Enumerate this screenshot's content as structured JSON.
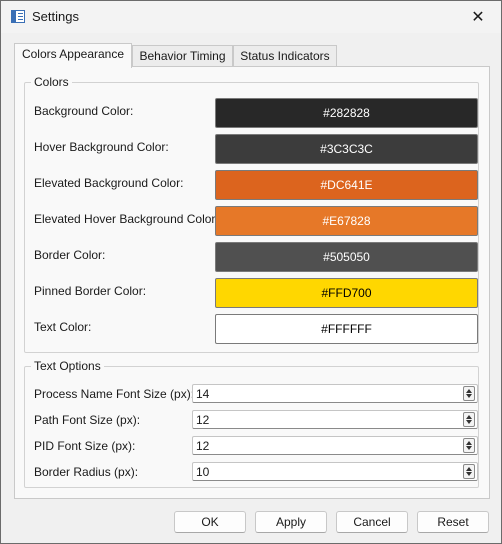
{
  "window": {
    "title": "Settings",
    "close_glyph": "✕"
  },
  "tabs": [
    {
      "label": "Colors  Appearance",
      "active": true
    },
    {
      "label": "Behavior  Timing",
      "active": false
    },
    {
      "label": "Status Indicators",
      "active": false
    }
  ],
  "colors_group": {
    "title": "Colors",
    "rows": [
      {
        "label": "Background Color:",
        "value": "#282828",
        "bg": "#282828",
        "fg": "#ffffff"
      },
      {
        "label": "Hover Background Color:",
        "value": "#3C3C3C",
        "bg": "#3c3c3c",
        "fg": "#ffffff"
      },
      {
        "label": "Elevated Background Color:",
        "value": "#DC641E",
        "bg": "#dc641e",
        "fg": "#ffffff"
      },
      {
        "label": "Elevated Hover Background Color:",
        "value": "#E67828",
        "bg": "#e67828",
        "fg": "#ffffff"
      },
      {
        "label": "Border Color:",
        "value": "#505050",
        "bg": "#505050",
        "fg": "#ffffff"
      },
      {
        "label": "Pinned Border Color:",
        "value": "#FFD700",
        "bg": "#ffd700",
        "fg": "#000000"
      },
      {
        "label": "Text Color:",
        "value": "#FFFFFF",
        "bg": "#ffffff",
        "fg": "#000000"
      }
    ]
  },
  "text_options": {
    "title": "Text Options",
    "rows": [
      {
        "label": "Process Name Font Size (px):",
        "value": "14"
      },
      {
        "label": "Path Font Size (px):",
        "value": "12"
      },
      {
        "label": "PID Font Size (px):",
        "value": "12"
      },
      {
        "label": "Border Radius (px):",
        "value": "10"
      }
    ]
  },
  "buttons": {
    "ok": "OK",
    "apply": "Apply",
    "cancel": "Cancel",
    "reset": "Reset"
  }
}
